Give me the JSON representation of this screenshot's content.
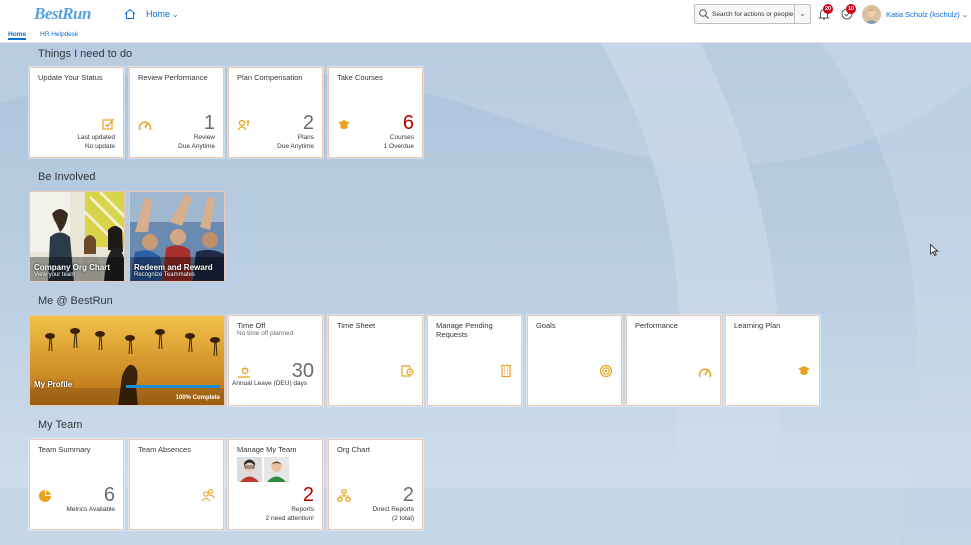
{
  "header": {
    "logo_text": "BestRun",
    "home_label": "Home",
    "search_placeholder": "Search for actions or people",
    "notifications_count": "20",
    "todo_count": "10",
    "user_name": "Katia Schulz (kschulz)"
  },
  "subnav": {
    "tabs": [
      {
        "label": "Home",
        "active": true
      },
      {
        "label": "HR Helpdesk",
        "active": false
      }
    ]
  },
  "sections": {
    "todo": "Things I need to do",
    "involved": "Be Involved",
    "me": "Me @ BestRun",
    "team": "My Team"
  },
  "todo_tiles": [
    {
      "title": "Update Your Status",
      "icon": "status-check-icon",
      "number": "",
      "footer1": "Last updated",
      "footer2": "No update"
    },
    {
      "title": "Review Performance",
      "icon": "gauge-icon",
      "number": "1",
      "footer1": "Review",
      "footer2": "Due Anytime"
    },
    {
      "title": "Plan Compensation",
      "icon": "compensation-icon",
      "number": "2",
      "footer1": "Plans",
      "footer2": "Due Anytime"
    },
    {
      "title": "Take Courses",
      "icon": "graduation-cap-icon",
      "number": "6",
      "footer1": "Courses",
      "footer2": "1 Overdue"
    }
  ],
  "involved_tiles": [
    {
      "title": "Company Org Chart",
      "subtitle": "View your team"
    },
    {
      "title": "Redeem and Reward",
      "subtitle": "Recognize Teammates"
    }
  ],
  "me_tiles": {
    "profile": {
      "title": "My Profile",
      "progress_label": "100% Complete",
      "progress": 1.0
    },
    "time_off": {
      "title": "Time Off",
      "subtitle": "No time off planned",
      "number": "30",
      "footer": "Annual Leave (DEU) days"
    },
    "others": [
      {
        "title": "Time Sheet",
        "icon": "timesheet-icon"
      },
      {
        "title": "Manage Pending Requests",
        "icon": "pending-requests-icon"
      },
      {
        "title": "Goals",
        "icon": "target-icon"
      },
      {
        "title": "Performance",
        "icon": "gauge-icon"
      },
      {
        "title": "Learning Plan",
        "icon": "graduation-cap-icon"
      }
    ]
  },
  "team_tiles": [
    {
      "title": "Team Summary",
      "icon": "pie-chart-icon",
      "number": "6",
      "footer1": "Metrics Available",
      "footer2": ""
    },
    {
      "title": "Team Absences",
      "icon": "people-icon",
      "number": "",
      "footer1": "",
      "footer2": ""
    },
    {
      "title": "Manage My Team",
      "icon": "",
      "number": "2",
      "footer1": "Reports",
      "footer2": "2 need attention!"
    },
    {
      "title": "Org Chart",
      "icon": "org-chart-icon",
      "number": "2",
      "footer1": "Direct Reports",
      "footer2": "(2 total)"
    }
  ],
  "colors": {
    "accent": "#0a6ed1",
    "icon": "#e9a21f",
    "alert": "#bb0000"
  }
}
